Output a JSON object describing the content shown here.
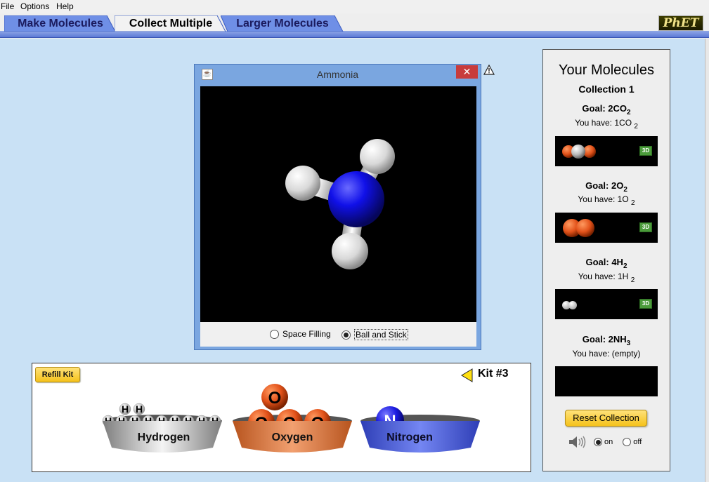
{
  "menu": {
    "file": "File",
    "options": "Options",
    "help": "Help"
  },
  "tabs": [
    {
      "label": "Make Molecules"
    },
    {
      "label": "Collect Multiple",
      "active": true
    },
    {
      "label": "Larger Molecules"
    }
  ],
  "logo": "PhET",
  "dialog": {
    "title": "Ammonia",
    "close_icon": "close-icon",
    "view_options": [
      {
        "label": "Space Filling",
        "selected": false
      },
      {
        "label": "Ball and Stick",
        "selected": true
      }
    ]
  },
  "kit": {
    "refill_label": "Refill Kit",
    "kit_label": "Kit #3",
    "buckets": [
      {
        "label": "Hydrogen",
        "atom": "H",
        "color": "#ffffff"
      },
      {
        "label": "Oxygen",
        "atom": "O",
        "color": "#e2521a"
      },
      {
        "label": "Nitrogen",
        "atom": "N",
        "color": "#1a1ae0"
      }
    ]
  },
  "collection": {
    "title": "Your Molecules",
    "subtitle": "Collection 1",
    "goals": [
      {
        "goal_prefix": "Goal: 2CO",
        "goal_sub": "2",
        "have_prefix": "You have: 1CO ",
        "have_sub": "2",
        "button": "3D"
      },
      {
        "goal_prefix": "Goal: 2O",
        "goal_sub": "2",
        "have_prefix": "You have: 1O ",
        "have_sub": "2",
        "button": "3D"
      },
      {
        "goal_prefix": "Goal: 4H",
        "goal_sub": "2",
        "have_prefix": "You have: 1H ",
        "have_sub": "2",
        "button": "3D"
      },
      {
        "goal_prefix": "Goal: 2NH",
        "goal_sub": "3",
        "have_prefix": "You have: (empty)",
        "have_sub": ""
      }
    ],
    "reset_label": "Reset Collection",
    "sound": {
      "on": "on",
      "off": "off",
      "selected": "on"
    }
  },
  "colors": {
    "background": "#c9e1f5",
    "tab_blue": "#6f8fe6",
    "oxygen": "#e2521a",
    "nitrogen": "#1a1ae0",
    "button_yellow": "#f5c21b"
  }
}
